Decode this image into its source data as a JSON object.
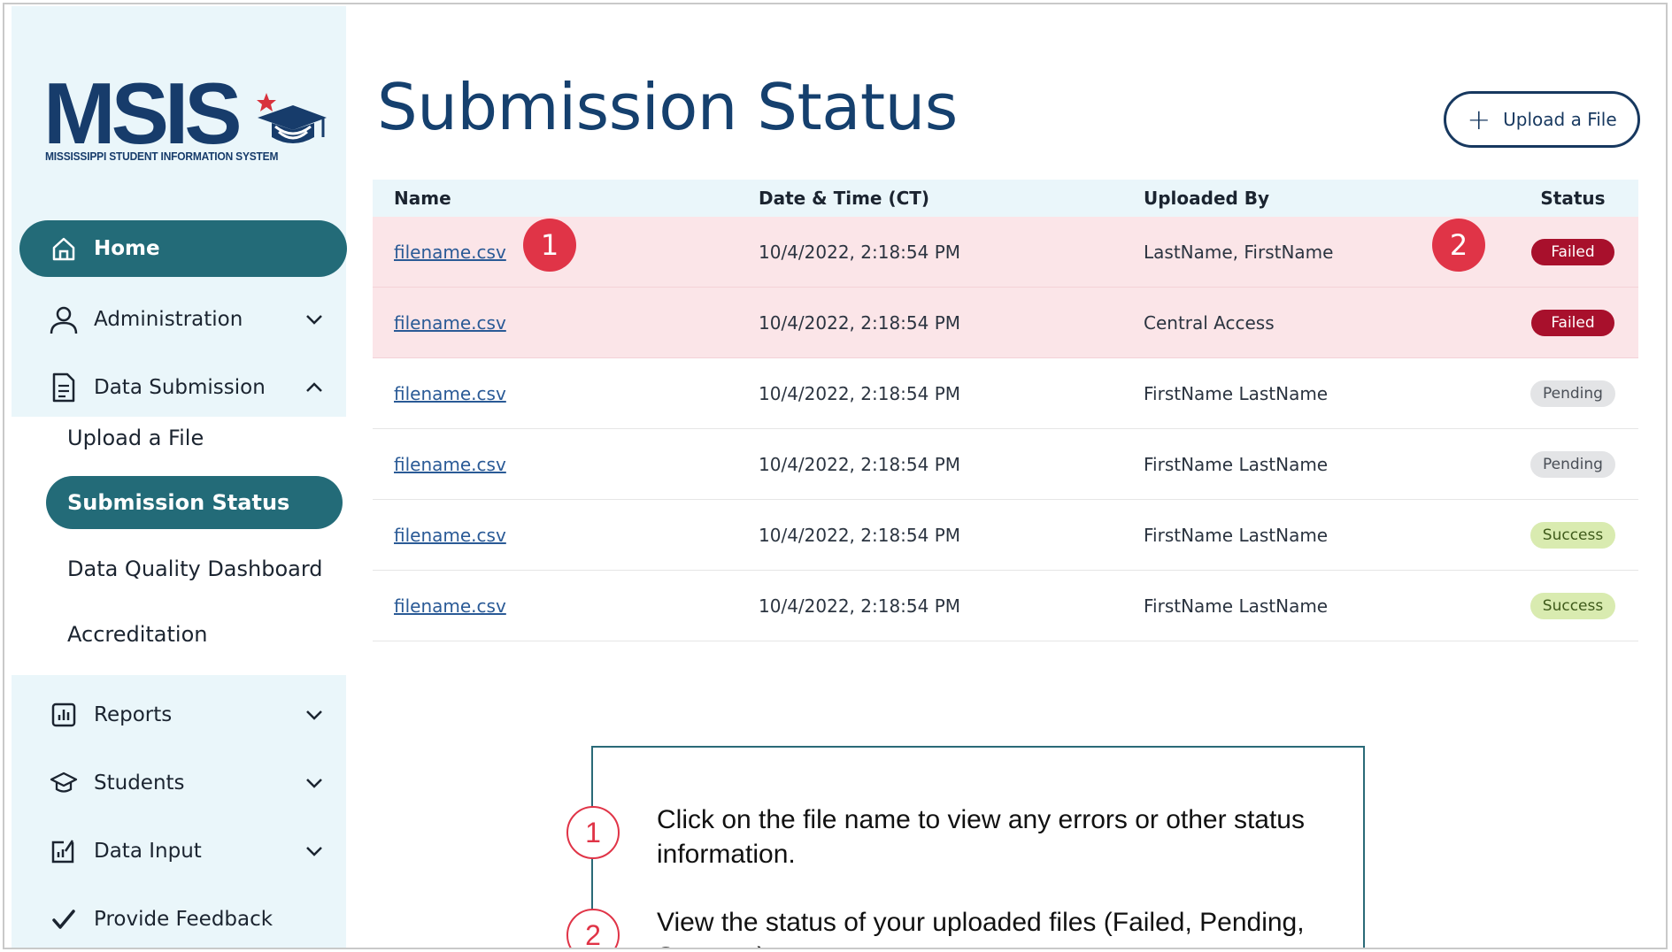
{
  "logo": {
    "word": "MSIS",
    "subtitle": "MISSISSIPPI STUDENT INFORMATION SYSTEM"
  },
  "sidebar": {
    "items": [
      {
        "label": "Home",
        "icon": "home-icon"
      },
      {
        "label": "Administration",
        "icon": "user-icon"
      },
      {
        "label": "Data Submission",
        "icon": "document-icon"
      },
      {
        "label": "Reports",
        "icon": "bar-chart-icon"
      },
      {
        "label": "Students",
        "icon": "graduation-cap-icon"
      },
      {
        "label": "Data Input",
        "icon": "edit-chart-icon"
      },
      {
        "label": "Provide Feedback",
        "icon": "checkmark-icon"
      }
    ],
    "sub_items": [
      {
        "label": "Upload a File"
      },
      {
        "label": "Submission Status"
      },
      {
        "label": "Data Quality Dashboard"
      },
      {
        "label": "Accreditation"
      }
    ]
  },
  "header": {
    "title": "Submission Status",
    "upload_button": "Upload a File"
  },
  "table": {
    "columns": [
      "Name",
      "Date & Time (CT)",
      "Uploaded By",
      "Status"
    ],
    "rows": [
      {
        "name": "filename.csv",
        "datetime": "10/4/2022, 2:18:54 PM",
        "uploaded_by": "LastName, FirstName",
        "status": "Failed"
      },
      {
        "name": "filename.csv",
        "datetime": "10/4/2022, 2:18:54 PM",
        "uploaded_by": "Central Access",
        "status": "Failed"
      },
      {
        "name": "filename.csv",
        "datetime": "10/4/2022, 2:18:54 PM",
        "uploaded_by": "FirstName LastName",
        "status": "Pending"
      },
      {
        "name": "filename.csv",
        "datetime": "10/4/2022, 2:18:54 PM",
        "uploaded_by": "FirstName LastName",
        "status": "Pending"
      },
      {
        "name": "filename.csv",
        "datetime": "10/4/2022, 2:18:54 PM",
        "uploaded_by": "FirstName LastName",
        "status": "Success"
      },
      {
        "name": "filename.csv",
        "datetime": "10/4/2022, 2:18:54 PM",
        "uploaded_by": "FirstName LastName",
        "status": "Success"
      }
    ]
  },
  "markers": [
    "1",
    "2"
  ],
  "callout": {
    "items": [
      {
        "num": "1",
        "text": "Click on the file name to view any errors or other status information."
      },
      {
        "num": "2",
        "text": "View the status of your uploaded files (Failed, Pending, Success)."
      }
    ]
  },
  "colors": {
    "accent": "#236b78",
    "title": "#15406e",
    "failed": "#a8102c",
    "pending": "#e3e4e6",
    "success": "#d9ebb0",
    "marker": "#e03447",
    "sidebar_bg": "#eaf6fa"
  }
}
